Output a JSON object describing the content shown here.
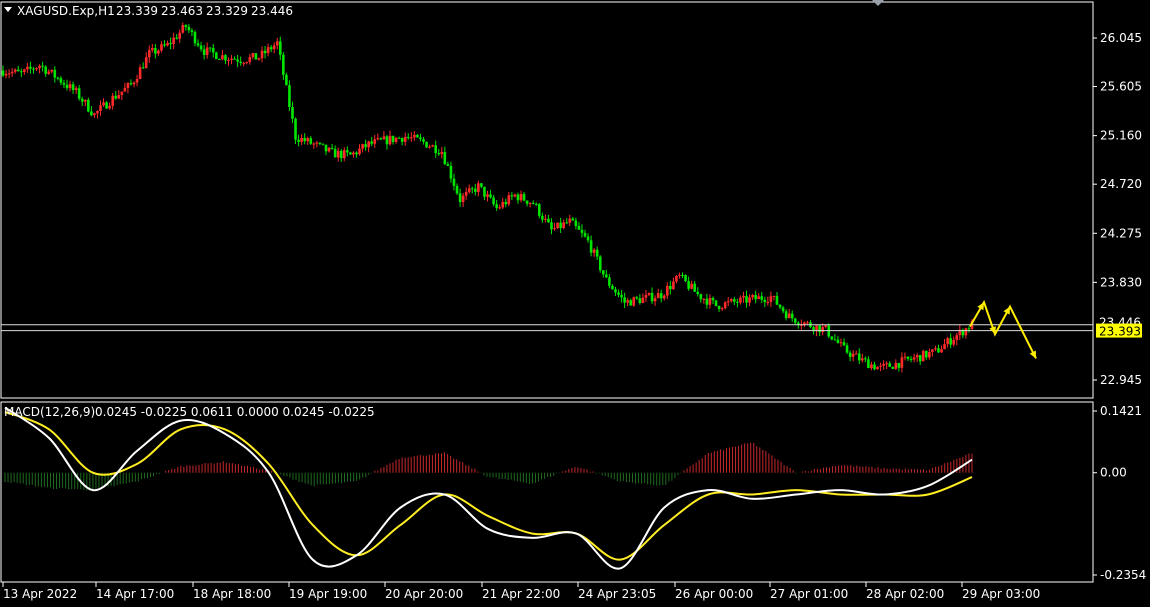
{
  "header": {
    "symbol": "XAGUSD.Exp,H1",
    "open": "23.339",
    "high": "23.463",
    "low": "23.329",
    "close": "23.446"
  },
  "macd_header": {
    "label": "MACD(12,26,9)",
    "values": "0.0245 -0.0225 0.0611 0.0000 0.0245 -0.0225"
  },
  "colors": {
    "background": "#000000",
    "frame": "#ffffff",
    "bull": "#ff2a2a",
    "bear": "#00e600",
    "hist_pos": "#c8282d",
    "hist_neg": "#1f6b1f",
    "macd": "#ffffff",
    "signal": "#ffee22",
    "arrow": "#ffee00",
    "price_label_bg": "#ffff00",
    "hline": "#dddddd"
  },
  "chart_data": [
    {
      "type": "candlestick",
      "symbol": "XAGUSD.Exp",
      "timeframe": "H1",
      "y_ticks": [
        "26.045",
        "25.605",
        "25.160",
        "24.720",
        "24.275",
        "23.830",
        "22.945"
      ],
      "ylim": [
        22.79,
        26.34
      ],
      "current_price": "23.393",
      "last_close_partial": "23.446",
      "x_ticks": [
        "13 Apr 2022",
        "14 Apr 17:00",
        "18 Apr 18:00",
        "19 Apr 19:00",
        "20 Apr 20:00",
        "21 Apr 22:00",
        "24 Apr 23:05",
        "26 Apr 00:00",
        "27 Apr 01:00",
        "28 Apr 02:00",
        "29 Apr 03:00"
      ],
      "close_path": [
        25.75,
        25.72,
        25.8,
        25.68,
        25.55,
        25.35,
        25.5,
        25.62,
        25.9,
        25.98,
        26.15,
        25.93,
        25.88,
        25.85,
        25.87,
        26.0,
        25.15,
        25.08,
        25.0,
        24.98,
        25.08,
        25.12,
        25.15,
        25.1,
        25.02,
        24.58,
        24.7,
        24.5,
        24.62,
        24.55,
        24.3,
        24.38,
        24.2,
        23.85,
        23.65,
        23.68,
        23.72,
        23.88,
        23.72,
        23.62,
        23.65,
        23.68,
        23.7,
        23.52,
        23.45,
        23.4,
        23.22,
        23.12,
        23.05,
        23.1,
        23.15,
        23.2,
        23.33,
        23.45
      ],
      "forecast_arrow": [
        23.43,
        23.65,
        23.36,
        23.61,
        23.14
      ]
    },
    {
      "type": "line",
      "title": "MACD(12,26,9)",
      "y_ticks": [
        "0.1421",
        "0.00",
        "-0.2354"
      ],
      "ylim": [
        -0.25,
        0.16
      ],
      "series": [
        {
          "values": [
            0.15,
            0.08,
            -0.04,
            0.05,
            0.12,
            0.09,
            0.0,
            -0.2,
            -0.19,
            -0.08,
            -0.05,
            -0.13,
            -0.15,
            -0.14,
            -0.22,
            -0.08,
            -0.04,
            -0.06,
            -0.05,
            -0.04,
            -0.05,
            -0.03,
            0.03
          ]
        },
        {
          "values": [
            0.14,
            0.1,
            0.0,
            0.02,
            0.1,
            0.1,
            0.02,
            -0.12,
            -0.19,
            -0.12,
            -0.05,
            -0.1,
            -0.14,
            -0.14,
            -0.2,
            -0.12,
            -0.05,
            -0.05,
            -0.04,
            -0.05,
            -0.05,
            -0.05,
            -0.01
          ]
        }
      ],
      "histogram": [
        -0.02,
        -0.035,
        -0.04,
        -0.02,
        0.015,
        0.025,
        0.005,
        -0.03,
        -0.02,
        0.035,
        0.045,
        -0.01,
        -0.025,
        0.015,
        -0.02,
        -0.03,
        0.045,
        0.07,
        0.0,
        0.018,
        0.01,
        0.006,
        0.045
      ]
    }
  ]
}
